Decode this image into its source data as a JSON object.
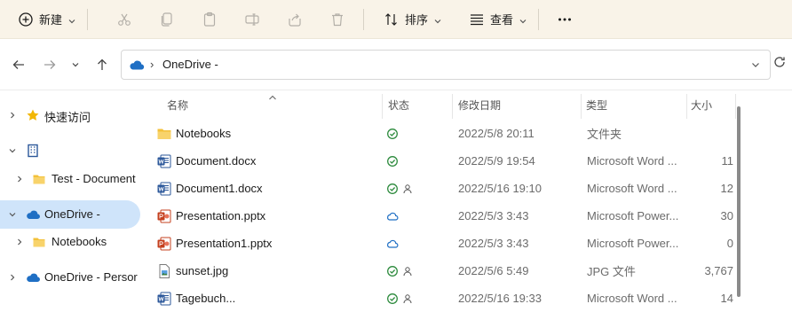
{
  "toolbar": {
    "new_label": "新建",
    "sort_label": "排序",
    "view_label": "查看"
  },
  "address": {
    "path": "OneDrive -",
    "separator": "›"
  },
  "sidebar": {
    "items": [
      {
        "label": "快速访问"
      },
      {
        "label": ""
      },
      {
        "label": "Test - Document"
      },
      {
        "label": "OneDrive -"
      },
      {
        "label": "Notebooks"
      },
      {
        "label": "OneDrive - Persor"
      }
    ]
  },
  "columns": {
    "name": "名称",
    "status": "状态",
    "modified": "修改日期",
    "type": "类型",
    "size": "大小"
  },
  "files": [
    {
      "name": "Notebooks",
      "icon": "folder-icon",
      "status": "check",
      "date": "2022/5/8 20:11",
      "type": "文件夹",
      "size": ""
    },
    {
      "name": "Document.docx",
      "icon": "word-icon",
      "status": "check",
      "date": "2022/5/9 19:54",
      "type": "Microsoft Word ...",
      "size": "11"
    },
    {
      "name": "Document1.docx",
      "icon": "word-icon",
      "status": "check-shared",
      "date": "2022/5/16 19:10",
      "type": "Microsoft Word ...",
      "size": "12"
    },
    {
      "name": "Presentation.pptx",
      "icon": "powerpoint-icon",
      "status": "cloud",
      "date": "2022/5/3 3:43",
      "type": "Microsoft Power...",
      "size": "30"
    },
    {
      "name": "Presentation1.pptx",
      "icon": "powerpoint-icon",
      "status": "cloud",
      "date": "2022/5/3 3:43",
      "type": "Microsoft Power...",
      "size": "0"
    },
    {
      "name": "sunset.jpg",
      "icon": "image-icon",
      "status": "check-shared",
      "date": "2022/5/6 5:49",
      "type": "JPG 文件",
      "size": "3,767"
    },
    {
      "name": "Tagebuch...",
      "icon": "word-icon",
      "status": "check-shared",
      "date": "2022/5/16 19:33",
      "type": "Microsoft Word ...",
      "size": "14"
    }
  ],
  "colors": {
    "toolbar_bg": "#f9f3e8",
    "selected_bg": "#cfe4fa",
    "check_green": "#2e8b3e",
    "cloud_blue": "#1f6fc4",
    "folder_yellow": "#f3c13a",
    "word_blue": "#2b579a",
    "ppt_red": "#c4401f"
  }
}
